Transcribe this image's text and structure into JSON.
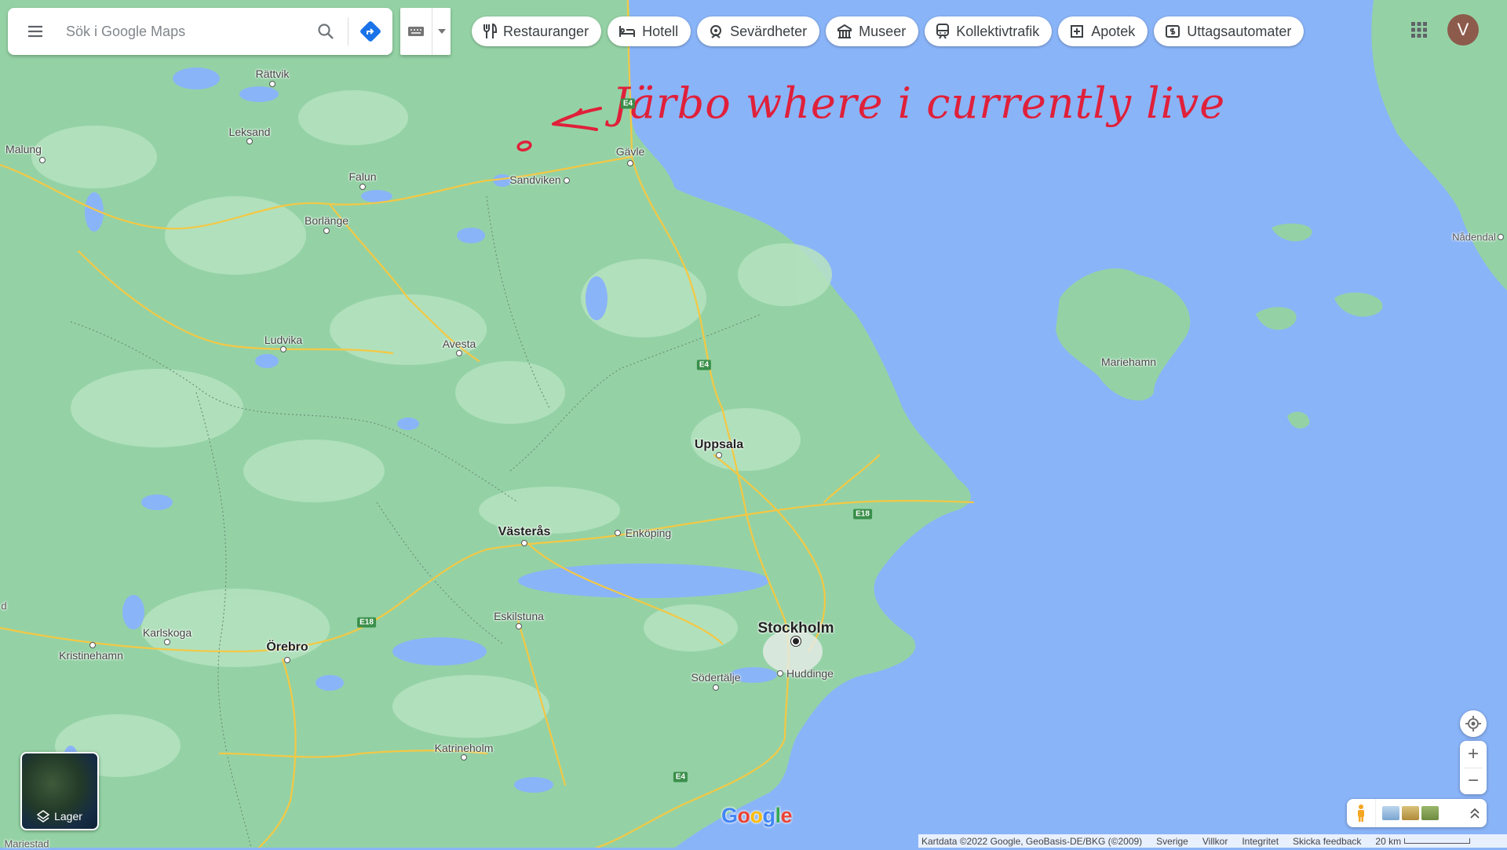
{
  "search": {
    "placeholder": "Sök i Google Maps"
  },
  "chips": [
    {
      "label": "Restauranger",
      "icon": "restaurant-icon"
    },
    {
      "label": "Hotell",
      "icon": "hotel-icon"
    },
    {
      "label": "Sevärdheter",
      "icon": "attraction-icon"
    },
    {
      "label": "Museer",
      "icon": "museum-icon"
    },
    {
      "label": "Kollektivtrafik",
      "icon": "transit-icon"
    },
    {
      "label": "Apotek",
      "icon": "pharmacy-icon"
    },
    {
      "label": "Uttagsautomater",
      "icon": "atm-icon"
    }
  ],
  "user": {
    "avatar_letter": "V",
    "avatar_color": "#8d5b4c"
  },
  "annotation": {
    "text": "Järbo where i currently live",
    "color": "#e0203a"
  },
  "places": {
    "rattvik": "Rättvik",
    "leksand": "Leksand",
    "malung": "Malung",
    "falun": "Falun",
    "sandviken": "Sandviken",
    "gavle": "Gävle",
    "borlange": "Borlänge",
    "ludvika": "Ludvika",
    "avesta": "Avesta",
    "uppsala": "Uppsala",
    "vasteras": "Västerås",
    "enkoping": "Enköping",
    "eskilstuna": "Eskilstuna",
    "stockholm": "Stockholm",
    "sodertalje": "Södertälje",
    "huddinge": "Huddinge",
    "karlskoga": "Karlskoga",
    "kristinehamn": "Kristinehamn",
    "orebro": "Örebro",
    "katrineholm": "Katrineholm",
    "mariehamn": "Mariehamn",
    "nadendal": "Nådendal",
    "mariestad": "Mariestad",
    "partial_d": "d"
  },
  "roads": {
    "e4": "E4",
    "e18": "E18"
  },
  "layers": {
    "label": "Lager"
  },
  "zoom": {
    "in": "+",
    "out": "−"
  },
  "logo": {
    "text": "Google"
  },
  "attribution": {
    "data": "Kartdata ©2022 Google, GeoBasis-DE/BKG (©2009)",
    "country": "Sverige",
    "terms": "Villkor",
    "privacy": "Integritet",
    "feedback": "Skicka feedback",
    "scale": "20 km"
  },
  "colors": {
    "water": "#8ab4f8",
    "land": "#94d2a5",
    "forest": "#b6e3c0",
    "road": "#f7d36b",
    "accent_blue": "#1a73e8"
  }
}
